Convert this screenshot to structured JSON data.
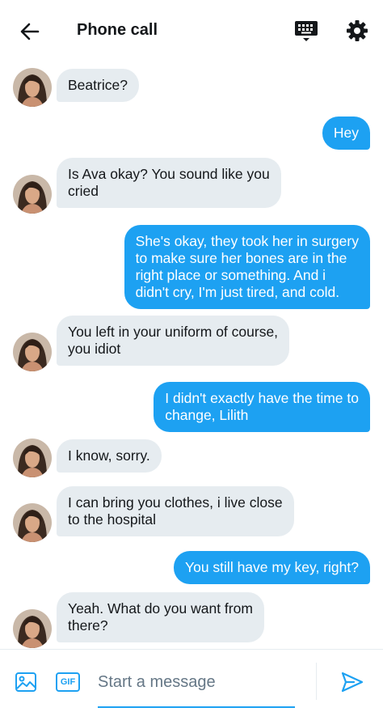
{
  "header": {
    "title": "Phone call",
    "icons": [
      "back-arrow-icon",
      "keyboard-icon",
      "gear-icon"
    ],
    "accent": "#000000"
  },
  "messages": [
    {
      "from": "them",
      "text": "Beatrice?"
    },
    {
      "from": "me",
      "text": "Hey"
    },
    {
      "from": "them",
      "text": "Is Ava okay? You sound like you\ncried"
    },
    {
      "from": "me",
      "text": "She's okay, they took her in surgery\nto make sure her bones are in the\nright place or something. And i\ndidn't cry, I'm just tired, and cold."
    },
    {
      "from": "them",
      "text": "You left in your uniform of course,\nyou idiot"
    },
    {
      "from": "me",
      "text": "I didn't exactly have the time to\nchange, Lilith"
    },
    {
      "from": "them",
      "text": "I know, sorry."
    },
    {
      "from": "them",
      "text": "I can bring you clothes, i live close\nto the hospital"
    },
    {
      "from": "me",
      "text": "You still have my key, right?"
    },
    {
      "from": "them",
      "text": "Yeah. What do you want from\nthere?"
    }
  ],
  "composer": {
    "gif_label": "GIF",
    "placeholder": "Start a message",
    "value": "",
    "icons": [
      "image-icon",
      "gif-icon",
      "send-icon"
    ]
  },
  "colors": {
    "outgoing_bubble": "#1da1f2",
    "incoming_bubble": "#e6ecf0",
    "accent": "#1da1f2"
  }
}
